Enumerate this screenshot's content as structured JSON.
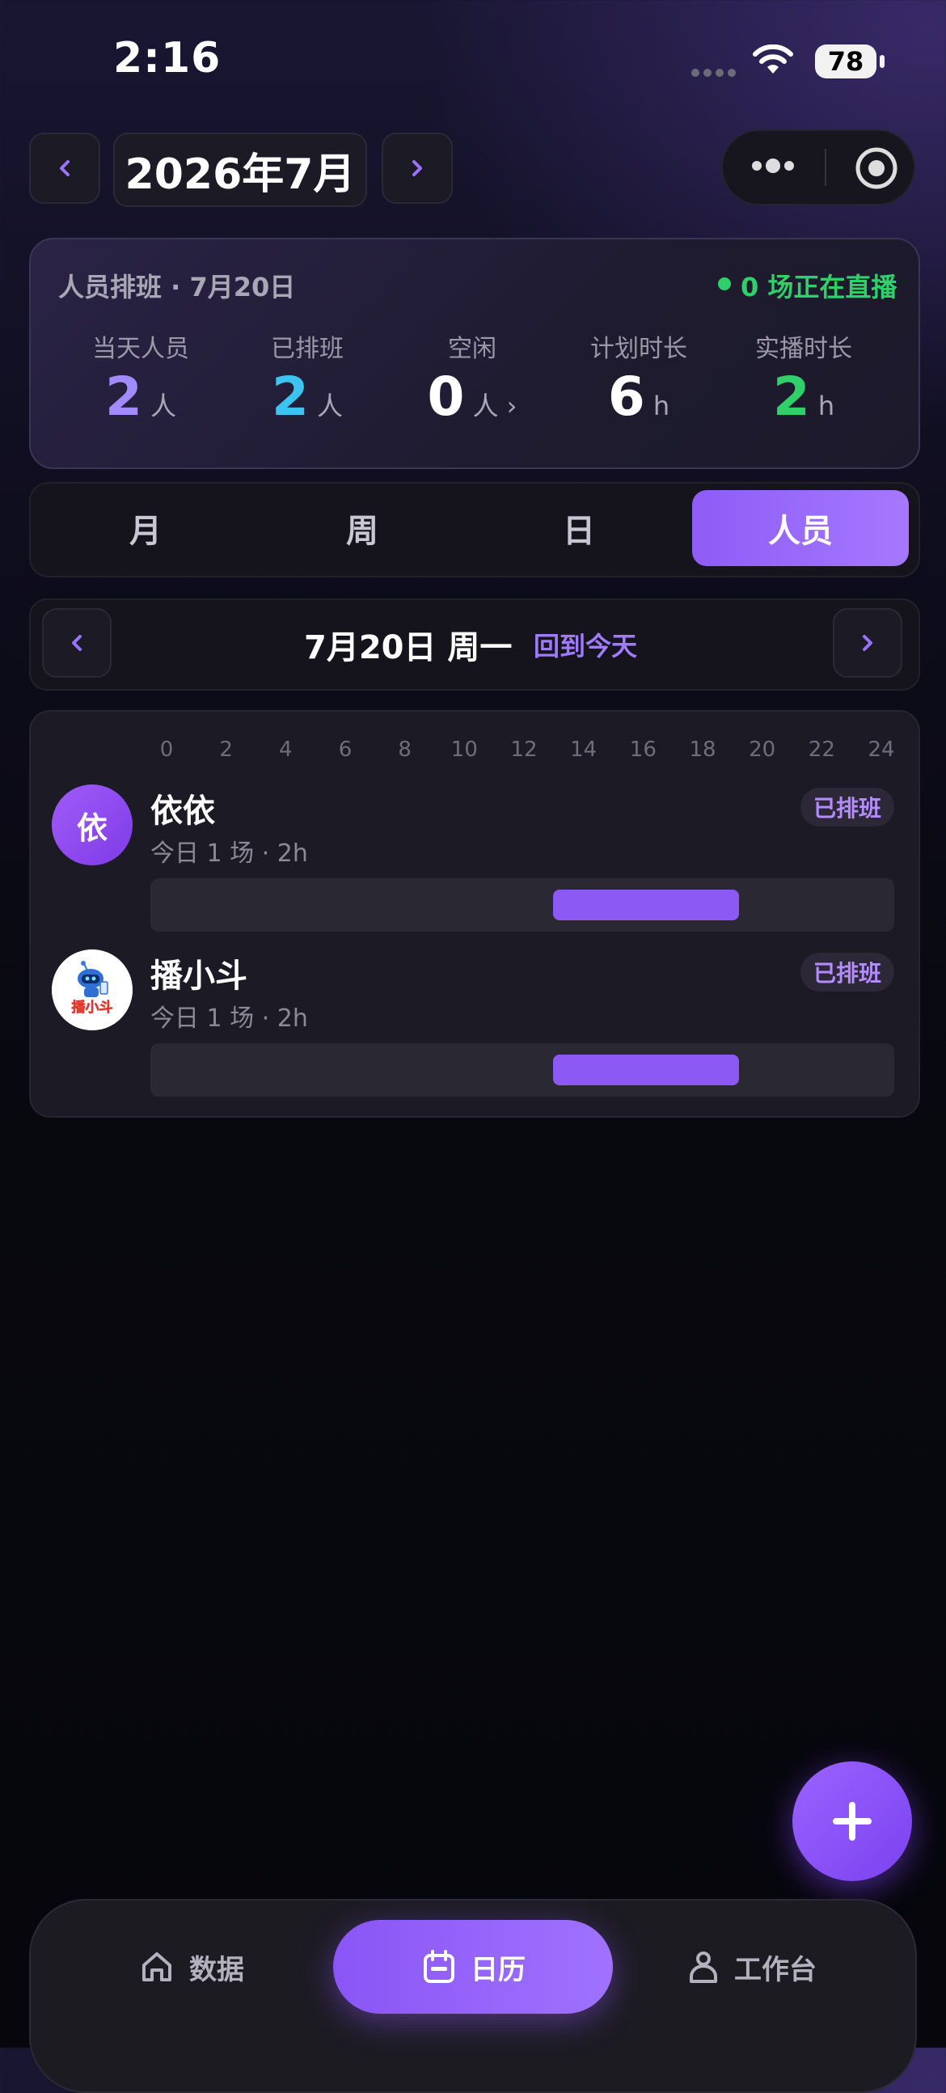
{
  "status_bar": {
    "time": "2:16",
    "battery": "78"
  },
  "header": {
    "month_title": "2026年7月"
  },
  "summary": {
    "title": "人员排班 · 7月20日",
    "live_text": "0 场正在直播",
    "stats": [
      {
        "label": "当天人员",
        "value": "2",
        "unit": "人",
        "color": "#a18bff"
      },
      {
        "label": "已排班",
        "value": "2",
        "unit": "人",
        "color": "#3cc3f0"
      },
      {
        "label": "空闲",
        "value": "0",
        "unit": "人 ›",
        "color": "#ffffff"
      },
      {
        "label": "计划时长",
        "value": "6",
        "unit": "h",
        "color": "#ffffff"
      },
      {
        "label": "实播时长",
        "value": "2",
        "unit": "h",
        "color": "#2fcf6a"
      }
    ]
  },
  "view_tabs": [
    {
      "label": "月",
      "active": false
    },
    {
      "label": "周",
      "active": false
    },
    {
      "label": "日",
      "active": false
    },
    {
      "label": "人员",
      "active": true
    }
  ],
  "date_nav": {
    "day_label": "7月20日 周一",
    "today_link": "回到今天"
  },
  "timeline": {
    "ticks": [
      "0",
      "2",
      "4",
      "6",
      "8",
      "10",
      "12",
      "14",
      "16",
      "18",
      "20",
      "22",
      "24"
    ],
    "people": [
      {
        "name": "依依",
        "avatar_text": "依",
        "sub": "今日 1 场 · 2h",
        "badge": "已排班",
        "slot_start": 13,
        "slot_end": 19
      },
      {
        "name": "播小斗",
        "avatar_text": "播小斗",
        "sub": "今日 1 场 · 2h",
        "badge": "已排班",
        "slot_start": 13,
        "slot_end": 19
      }
    ]
  },
  "tabbar": {
    "items": [
      {
        "label": "数据",
        "icon": "home-icon"
      },
      {
        "label": "日历",
        "icon": "calendar-icon",
        "active": true
      },
      {
        "label": "工作台",
        "icon": "user-icon"
      }
    ]
  }
}
